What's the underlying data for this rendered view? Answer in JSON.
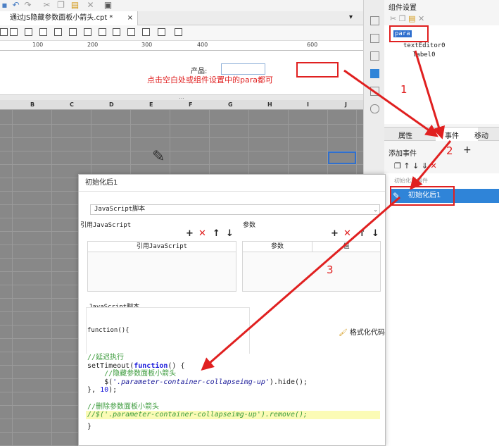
{
  "tab": {
    "filename": "通过JS隐藏参数面板小箭头.cpt *",
    "close": "×"
  },
  "ruler": [
    "100",
    "200",
    "300",
    "400",
    "600"
  ],
  "param_panel": {
    "label": "产品:",
    "hint": "点击空白处或组件设置中的para都可"
  },
  "splitter": "...",
  "grid": {
    "columns": [
      "B",
      "C",
      "D",
      "E",
      "F",
      "G",
      "H",
      "I",
      "J"
    ]
  },
  "right_panel": {
    "title": "组件设置",
    "tree": [
      "para",
      "textEditor0",
      "label0"
    ],
    "tabs": [
      "属性",
      "事件",
      "移动"
    ],
    "add_event": "添加事件",
    "add_plus": "+",
    "event_caption": "初始化后事件",
    "event_item": "初始化后1"
  },
  "dialog": {
    "title": "初始化后1",
    "script_type": "JavaScript脚本",
    "ref_js_label": "引用JavaScript",
    "params_label": "参数",
    "table1_header": "引用JavaScript",
    "table2_headers": [
      "参数",
      "值"
    ],
    "script_label": "JavaScript脚本",
    "function_sig": "function(){",
    "format_code": "格式化代码",
    "code_lines": [
      "//延迟执行",
      "setTimeout(function() {",
      "    //隐藏参数面板小箭头",
      "    $('.parameter-container-collapseimg-up').hide();",
      "}, 10);",
      "",
      "//删除参数面板小箭头",
      "//$('.parameter-container-collapseimg-up').remove();",
      "}"
    ]
  },
  "annotations": [
    "1",
    "2",
    "3"
  ],
  "colors": {
    "annotation": "#e02020",
    "selection": "#2f84d8"
  }
}
